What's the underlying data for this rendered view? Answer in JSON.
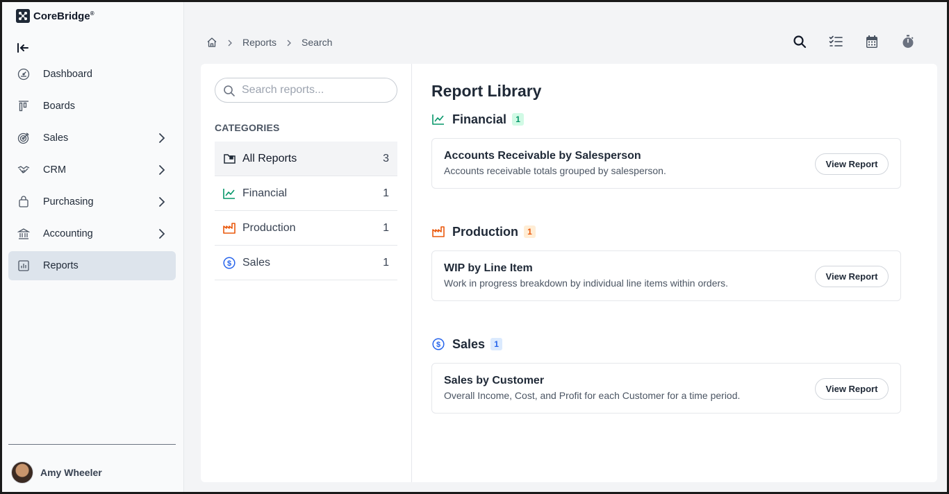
{
  "brand": {
    "name": "CoreBridge",
    "mark": "®"
  },
  "sidebar": {
    "items": [
      {
        "label": "Dashboard",
        "icon": "dashboard-gauge-icon",
        "has_submenu": false,
        "active": false
      },
      {
        "label": "Boards",
        "icon": "boards-kanban-icon",
        "has_submenu": false,
        "active": false
      },
      {
        "label": "Sales",
        "icon": "sales-target-icon",
        "has_submenu": true,
        "active": false
      },
      {
        "label": "CRM",
        "icon": "crm-handshake-icon",
        "has_submenu": true,
        "active": false
      },
      {
        "label": "Purchasing",
        "icon": "purchasing-bag-icon",
        "has_submenu": true,
        "active": false
      },
      {
        "label": "Accounting",
        "icon": "accounting-bank-icon",
        "has_submenu": true,
        "active": false
      },
      {
        "label": "Reports",
        "icon": "reports-chart-icon",
        "has_submenu": false,
        "active": true
      }
    ],
    "user": {
      "name": "Amy Wheeler"
    }
  },
  "breadcrumb": {
    "items": [
      "Reports",
      "Search"
    ]
  },
  "topbar": {
    "icons": [
      "search-icon",
      "checklist-icon",
      "calendar-icon",
      "timer-icon"
    ]
  },
  "categories": {
    "search_placeholder": "Search reports...",
    "heading": "CATEGORIES",
    "items": [
      {
        "label": "All Reports",
        "count": "3",
        "active": true,
        "icon": "folder-icon",
        "color": "#1f2937"
      },
      {
        "label": "Financial",
        "count": "1",
        "active": false,
        "icon": "line-chart-icon",
        "color": "#059669"
      },
      {
        "label": "Production",
        "count": "1",
        "active": false,
        "icon": "factory-icon",
        "color": "#ea580c"
      },
      {
        "label": "Sales",
        "count": "1",
        "active": false,
        "icon": "dollar-circle-icon",
        "color": "#2563eb"
      }
    ]
  },
  "library": {
    "title": "Report Library",
    "groups": [
      {
        "name": "Financial",
        "count": "1",
        "icon": "line-chart-icon",
        "color": "#059669",
        "badge_bg": "#d1fae5",
        "reports": [
          {
            "title": "Accounts Receivable by Salesperson",
            "description": "Accounts receivable totals grouped by salesperson.",
            "button": "View Report"
          }
        ]
      },
      {
        "name": "Production",
        "count": "1",
        "icon": "factory-icon",
        "color": "#ea580c",
        "badge_bg": "#ffedd5",
        "reports": [
          {
            "title": "WIP by Line Item",
            "description": "Work in progress breakdown by individual line items within orders.",
            "button": "View Report"
          }
        ]
      },
      {
        "name": "Sales",
        "count": "1",
        "icon": "dollar-circle-icon",
        "color": "#2563eb",
        "badge_bg": "#dbeafe",
        "reports": [
          {
            "title": "Sales by Customer",
            "description": "Overall Income, Cost, and Profit for each Customer for a time period.",
            "button": "View Report"
          }
        ]
      }
    ]
  }
}
